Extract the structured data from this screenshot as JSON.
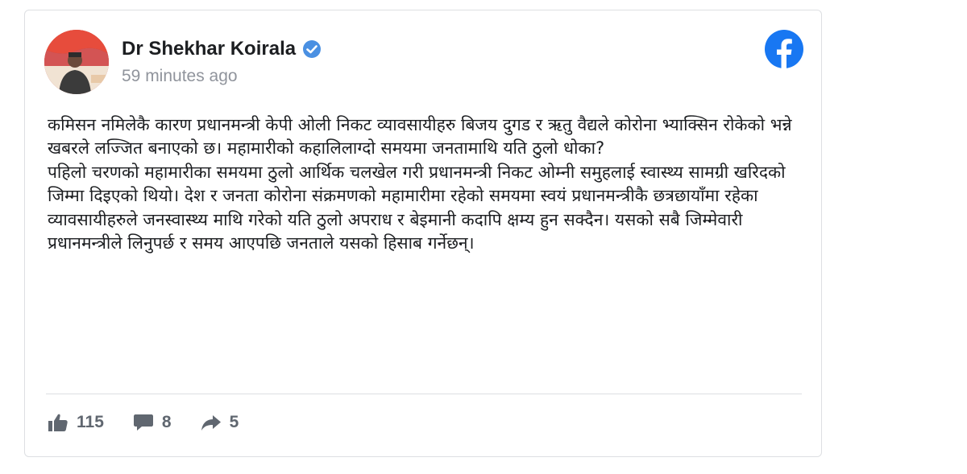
{
  "post": {
    "author": "Dr Shekhar Koirala",
    "time": "59 minutes ago",
    "paragraph1": "कमिसन नमिलेकै कारण प्रधानमन्त्री केपी ओली निकट व्यावसायीहरु बिजय दुगड र ऋतु वैद्यले कोरोना भ्याक्सिन रोकेको भन्ने खबरले लज्जित बनाएको छ। महामारीको कहालिलाग्दो समयमा जनतामाथि यति ठुलो धोका?",
    "paragraph2": "पहिलो चरणको महामारीका समयमा ठुलो आर्थिक चलखेल गरी प्रधानमन्त्री निकट ओम्नी समुहलाई स्वास्थ्य सामग्री खरिदको जिम्मा दिइएको थियो। देश र जनता कोरोना संक्रमणको महामारीमा रहेको समयमा स्वयं प्रधानमन्त्रीकै छत्रछायाँमा रहेका व्यावसायीहरुले जनस्वास्थ्य माथि गरेको यति ठुलो अपराध र बेइमानी कदापि क्षम्य हुन सक्दैन। यसको सबै जिम्मेवारी प्रधानमन्त्रीले लिनुपर्छ र समय आएपछि जनताले यसको हिसाब गर्नेछन्।"
  },
  "stats": {
    "likes": "115",
    "comments": "8",
    "shares": "5"
  },
  "icons": {
    "verified": "verified-badge-icon",
    "platform": "facebook-logo-icon",
    "like": "thumbs-up-icon",
    "comment": "comment-icon",
    "share": "share-arrow-icon"
  },
  "colors": {
    "facebook_blue": "#1877f2",
    "verified_blue": "#4a90e2",
    "muted": "#606770"
  }
}
